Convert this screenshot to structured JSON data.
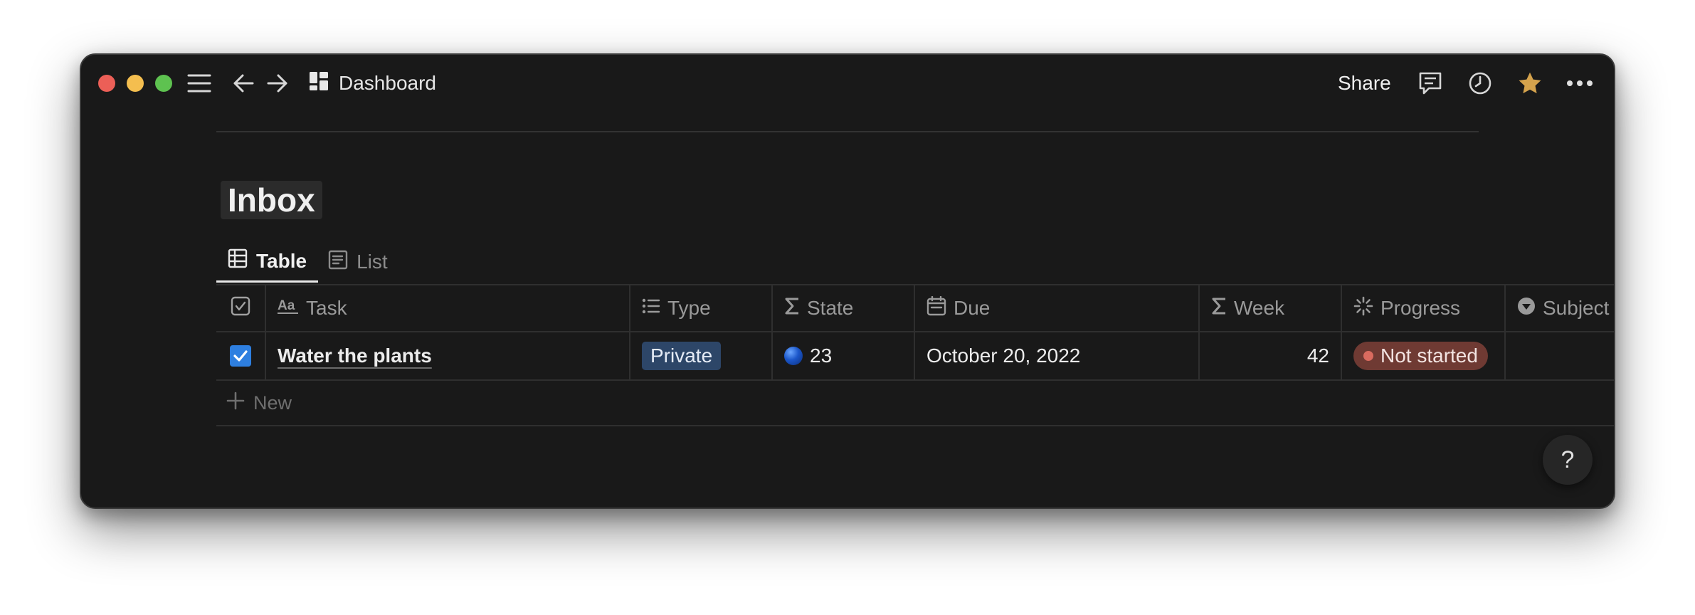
{
  "titlebar": {
    "breadcrumb": "Dashboard",
    "share_label": "Share"
  },
  "page": {
    "title": "Inbox"
  },
  "tabs": [
    {
      "label": "Table",
      "icon": "table-icon",
      "active": true
    },
    {
      "label": "List",
      "icon": "list-view-icon",
      "active": false
    }
  ],
  "table": {
    "columns": [
      {
        "label": "",
        "icon": "checkbox-icon"
      },
      {
        "label": "Task",
        "icon": "text-property-icon"
      },
      {
        "label": "Type",
        "icon": "multi-select-icon"
      },
      {
        "label": "State",
        "icon": "formula-icon"
      },
      {
        "label": "Due",
        "icon": "calendar-icon"
      },
      {
        "label": "Week",
        "icon": "formula-icon"
      },
      {
        "label": "Progress",
        "icon": "status-icon"
      },
      {
        "label": "Subject",
        "icon": "select-icon"
      }
    ],
    "rows": [
      {
        "done": true,
        "task": "Water the plants",
        "type": "Private",
        "state": "23",
        "due": "October 20, 2022",
        "week": "42",
        "progress": "Not started",
        "subject": ""
      }
    ],
    "new_label": "New"
  },
  "help_label": "?",
  "colors": {
    "background": "#191919",
    "private_tag": "#2d4668",
    "not_started_badge": "#6f3a33",
    "checkbox": "#2e7fe0",
    "favorite_star": "#d4a24c"
  }
}
